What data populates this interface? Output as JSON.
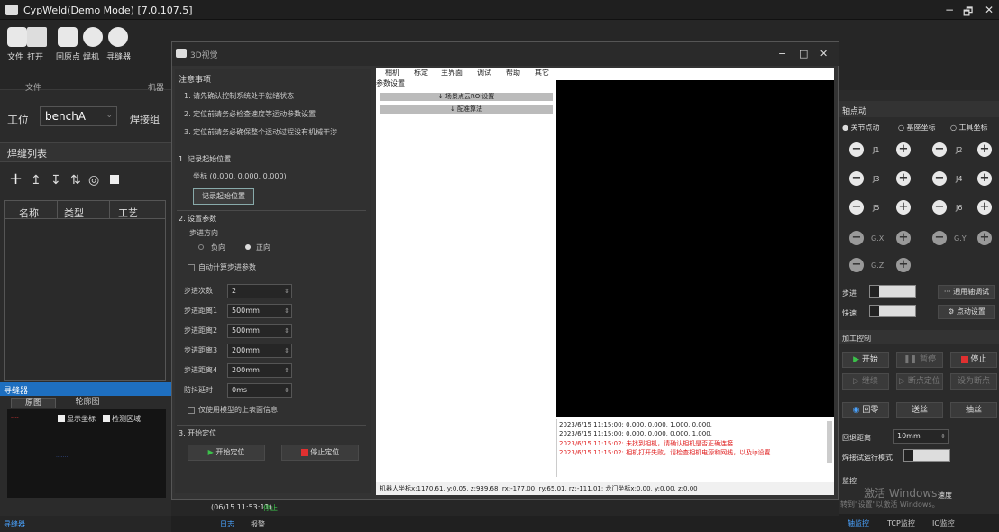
{
  "app": {
    "title": "CypWeld(Demo Mode) [7.0.107.5]",
    "min": "−",
    "max": "🗗",
    "close": "✕"
  },
  "ribbon": {
    "items": [
      "文件",
      "打开",
      "回原点",
      "焊机",
      "寻缝器"
    ],
    "group_file": "文件",
    "group_machine": "机器"
  },
  "left": {
    "station_label": "工位",
    "station_value": "benchA",
    "weld_group_label": "焊接组",
    "seam_list_title": "焊缝列表",
    "columns": [
      "名称",
      "类型",
      "工艺"
    ],
    "seeker_title": "寻缝器",
    "tabs": [
      "原图",
      "轮廓图"
    ],
    "show_coords": "显示坐标",
    "detect_region": "检测区域",
    "bottom_status": "寻缝器"
  },
  "dialog": {
    "title": "3D视觉",
    "min": "−",
    "max": "□",
    "close": "✕",
    "notes_title": "注意事项",
    "notes": [
      "1. 请先确认控制系统处于就绪状态",
      "2. 定位前请务必检查速度等运动参数设置",
      "3. 定位前请务必确保整个运动过程没有机械干涉"
    ],
    "sec1_title": "1. 记录起始位置",
    "coord_text": "坐标  (0.000, 0.000, 0.000)",
    "record_button": "记录起始位置",
    "sec2_title": "2. 设置参数",
    "direction_title": "步进方向",
    "dir_neg": "负向",
    "dir_pos": "正向",
    "auto_calc": "自动计算步进参数",
    "params": [
      {
        "label": "步进次数",
        "value": "2"
      },
      {
        "label": "步进距离1",
        "value": "500mm"
      },
      {
        "label": "步进距离2",
        "value": "500mm"
      },
      {
        "label": "步进距离3",
        "value": "200mm"
      },
      {
        "label": "步进距离4",
        "value": "200mm"
      },
      {
        "label": "防抖延时",
        "value": "0ms"
      }
    ],
    "only_model": "仅使用模型的上表面信息",
    "sec3_title": "3. 开始定位",
    "start_button": "开始定位",
    "stop_button": "停止定位",
    "menu": [
      "相机",
      "标定",
      "主界面",
      "调试",
      "帮助",
      "其它"
    ],
    "param_settings": "参数设置",
    "scene_btn": "↓ 场景点云ROI设置",
    "config_btn": "↓ 配准算法",
    "log": [
      {
        "text": "2023/6/15 11:15:00:  0.000, 0.000, 1.000, 0.000,",
        "color": "#222222"
      },
      {
        "text": "2023/6/15 11:15:00:  0.000, 0.000, 0.000, 1.000,",
        "color": "#222222"
      },
      {
        "text": "2023/6/15 11:15:02:  未找到相机，请确认相机是否正确连接",
        "color": "#e02020"
      },
      {
        "text": "2023/6/15 11:15:02:  相机打开失败，请检查相机电源和网线，以及ip设置",
        "color": "#e02020"
      }
    ],
    "status_bar": "机器人坐标x:1170.61, y:0.05, z:939.68, rx:-177.00, ry:65.01, rz:-111.01; 龙门坐标x:0.00, y:0.00, z:0.00"
  },
  "center_bottom": {
    "time_status": "(06/15 11:53:11)",
    "time_status_tail": "停止",
    "tab_log": "日志",
    "tab_alarm": "报警"
  },
  "right": {
    "jog_title": "轴点动",
    "mode_joint": "关节点动",
    "mode_base": "基座坐标",
    "mode_tool": "工具坐标",
    "joints": [
      "J1",
      "J2",
      "J3",
      "J4",
      "J5",
      "J6",
      "G.X",
      "G.Y",
      "G.Z"
    ],
    "step_label": "步进",
    "fast_label": "快速",
    "general_debug": "通用轴调试",
    "jog_settings": "点动设置",
    "process_title": "加工控制",
    "start": "开始",
    "pause": "暂停",
    "stop": "停止",
    "continue": "继续",
    "breakpoint": "断点定位",
    "set_breakpoint": "设为断点",
    "home": "回零",
    "feed": "送丝",
    "retract": "抽丝",
    "back_distance_label": "回退距离",
    "back_distance_value": "10mm",
    "weld_test_mode": "焊接试运行模式",
    "monitor_title": "监控",
    "speed_col": "速度",
    "tab_axis": "轴监控",
    "tab_tcp": "TCP监控",
    "tab_io": "IO监控"
  },
  "watermark": {
    "line1": "激活 Windows",
    "line2": "转到\"设置\"以激活 Windows。"
  }
}
